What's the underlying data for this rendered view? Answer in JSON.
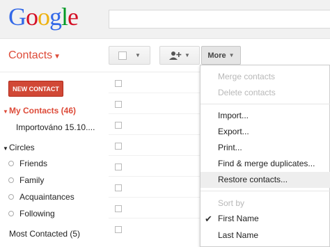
{
  "header": {
    "logo": {
      "letters": [
        {
          "char": "G",
          "color": "#3369e8"
        },
        {
          "char": "o",
          "color": "#d50f25"
        },
        {
          "char": "o",
          "color": "#eeb211"
        },
        {
          "char": "g",
          "color": "#3369e8"
        },
        {
          "char": "l",
          "color": "#009925"
        },
        {
          "char": "e",
          "color": "#d50f25"
        }
      ]
    },
    "search": {
      "value": ""
    }
  },
  "app_title": "Contacts",
  "toolbar": {
    "select_icon": "checkbox-icon",
    "add_icon": "add-person-icon",
    "more_label": "More"
  },
  "sidebar": {
    "new_contact_label": "NEW CONTACT",
    "my_contacts_label": "My Contacts (46)",
    "imported_label": "Importováno 15.10....",
    "circles_label": "Circles",
    "circle_items": [
      "Friends",
      "Family",
      "Acquaintances",
      "Following"
    ],
    "most_contacted_label": "Most Contacted (5)"
  },
  "menu": {
    "items_group1": [
      "Merge contacts",
      "Delete contacts"
    ],
    "items_group2": [
      "Import...",
      "Export...",
      "Print...",
      "Find & merge duplicates...",
      "Restore contacts..."
    ],
    "sort_header": "Sort by",
    "sort_options": [
      "First Name",
      "Last Name"
    ],
    "sort_selected": "First Name"
  },
  "colors": {
    "accent_red": "#dd4b39",
    "new_contact_bg": "#d14836"
  }
}
